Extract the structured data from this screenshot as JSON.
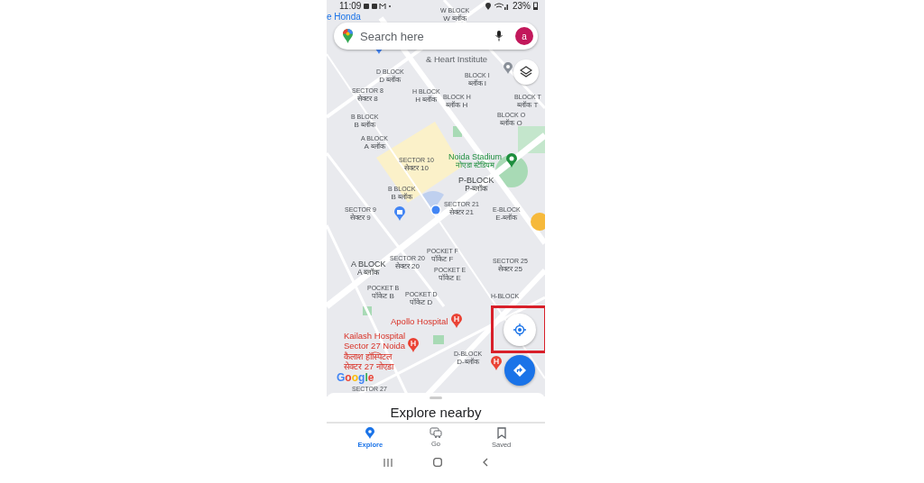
{
  "status_bar": {
    "time": "11:09",
    "battery": "23%"
  },
  "search": {
    "placeholder": "Search here",
    "avatar_letter": "a"
  },
  "map_labels": [
    {
      "kind": "poi_blue",
      "lines": [
        "e Honda"
      ]
    },
    {
      "kind": "block",
      "lines": [
        "W BLOCK",
        "W ब्लॉक"
      ]
    },
    {
      "kind": "poi_gray",
      "lines": [
        "& Heart Institute"
      ]
    },
    {
      "kind": "block",
      "lines": [
        "D BLOCK",
        "D ब्लॉक"
      ]
    },
    {
      "kind": "block",
      "lines": [
        "BLOCK I",
        "ब्लॉक I"
      ]
    },
    {
      "kind": "block",
      "lines": [
        "SECTOR 8",
        "सेक्टर 8"
      ]
    },
    {
      "kind": "block",
      "lines": [
        "H BLOCK",
        "H ब्लॉक"
      ]
    },
    {
      "kind": "block",
      "lines": [
        "BLOCK H",
        "ब्लॉक H"
      ]
    },
    {
      "kind": "block",
      "lines": [
        "BLOCK T",
        "ब्लॉक T"
      ]
    },
    {
      "kind": "block",
      "lines": [
        "B BLOCK",
        "B ब्लॉक"
      ]
    },
    {
      "kind": "block",
      "lines": [
        "BLOCK O",
        "ब्लॉक O"
      ]
    },
    {
      "kind": "block",
      "lines": [
        "A BLOCK",
        "A ब्लॉक"
      ]
    },
    {
      "kind": "block",
      "lines": [
        "SECTOR 10",
        "सेक्टर 10"
      ]
    },
    {
      "kind": "poi_green",
      "lines": [
        "Noida Stadium",
        "नोएडा स्टेडियम"
      ]
    },
    {
      "kind": "area",
      "lines": [
        "P-BLOCK",
        "P-ब्लॉक"
      ]
    },
    {
      "kind": "block",
      "lines": [
        "B BLOCK",
        "B ब्लॉक"
      ]
    },
    {
      "kind": "block",
      "lines": [
        "SECTOR 21",
        "सेक्टर 21"
      ]
    },
    {
      "kind": "block",
      "lines": [
        "SECTOR 9",
        "सेक्टर 9"
      ]
    },
    {
      "kind": "block",
      "lines": [
        "E-BLOCK",
        "E-ब्लॉक"
      ]
    },
    {
      "kind": "block",
      "lines": [
        "POCKET F",
        "पॉकेट F"
      ]
    },
    {
      "kind": "block",
      "lines": [
        "SECTOR 20",
        "सेक्टर 20"
      ]
    },
    {
      "kind": "area",
      "lines": [
        "A BLOCK",
        "A ब्लॉक"
      ]
    },
    {
      "kind": "block",
      "lines": [
        "POCKET E",
        "पॉकेट E"
      ]
    },
    {
      "kind": "block",
      "lines": [
        "SECTOR 25",
        "सेक्टर 25"
      ]
    },
    {
      "kind": "block",
      "lines": [
        "POCKET B",
        "पॉकेट B"
      ]
    },
    {
      "kind": "block",
      "lines": [
        "POCKET D",
        "पॉकेट D"
      ]
    },
    {
      "kind": "block",
      "lines": [
        "H-BLOCK"
      ]
    },
    {
      "kind": "poi_red",
      "lines": [
        "Apollo Hospital"
      ]
    },
    {
      "kind": "poi_red",
      "lines": [
        "Kailash Hospital",
        "Sector 27 Noida",
        "कैलाश हॉस्पिटल",
        "सेक्टर 27 नोएडा"
      ]
    },
    {
      "kind": "block",
      "lines": [
        "D-BLOCK",
        "D-ब्लॉक"
      ]
    },
    {
      "kind": "block",
      "lines": [
        "SECTOR 27"
      ]
    }
  ],
  "map_logo": "Google",
  "sheet": {
    "title": "Explore nearby"
  },
  "tabs": [
    {
      "kind": "explore",
      "label": "Explore",
      "selected": true
    },
    {
      "kind": "go",
      "label": "Go",
      "selected": false
    },
    {
      "kind": "saved",
      "label": "Saved",
      "selected": false
    }
  ]
}
